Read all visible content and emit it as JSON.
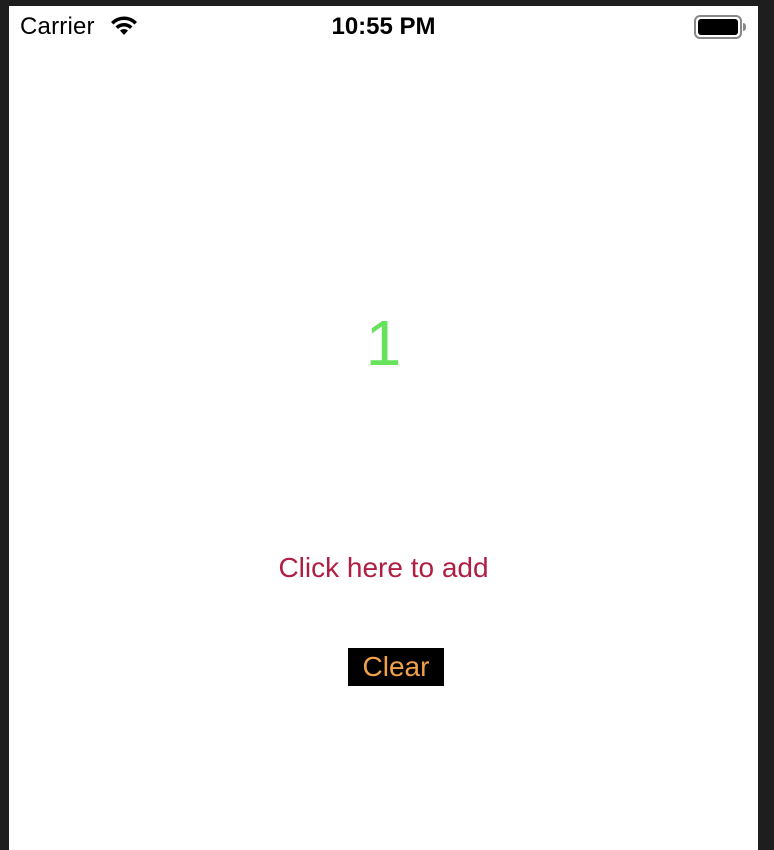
{
  "status_bar": {
    "carrier": "Carrier",
    "time": "10:55 PM",
    "wifi_icon": "wifi-icon",
    "battery_icon": "battery-icon"
  },
  "counter": {
    "value": "1",
    "color": "#66e35a"
  },
  "add_link": {
    "label": "Click here to add",
    "color": "#b01f43"
  },
  "clear_button": {
    "label": "Clear",
    "text_color": "#f2a04a",
    "background": "#000000"
  }
}
